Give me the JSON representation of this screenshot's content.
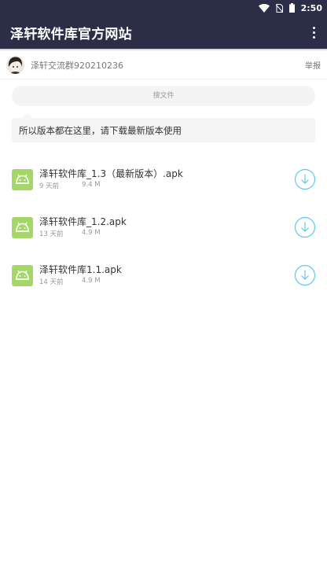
{
  "status_bar": {
    "time": "2:50",
    "icons": [
      "wifi-icon",
      "no-sim-icon",
      "battery-icon"
    ]
  },
  "app_bar": {
    "title": "泽轩软件库官方网站",
    "menu_icon": "more-vert-icon"
  },
  "uploader": {
    "name": "泽轩交流群920210236",
    "report_label": "举报"
  },
  "search": {
    "placeholder": "搜文件"
  },
  "notice": {
    "text": "所以版本都在这里，请下载最新版本使用"
  },
  "files": [
    {
      "name": "泽轩软件库_1.3（最新版本）.apk",
      "date": "9 天前",
      "size": "9.4 M"
    },
    {
      "name": "泽轩软件库_1.2.apk",
      "date": "13 天前",
      "size": "4.9 M"
    },
    {
      "name": "泽轩软件库1.1.apk",
      "date": "14 天前",
      "size": "4.9 M"
    }
  ],
  "colors": {
    "header_bg": "#2c2d46",
    "apk_icon": "#a4d768",
    "download_accent": "#5ec8ec"
  }
}
